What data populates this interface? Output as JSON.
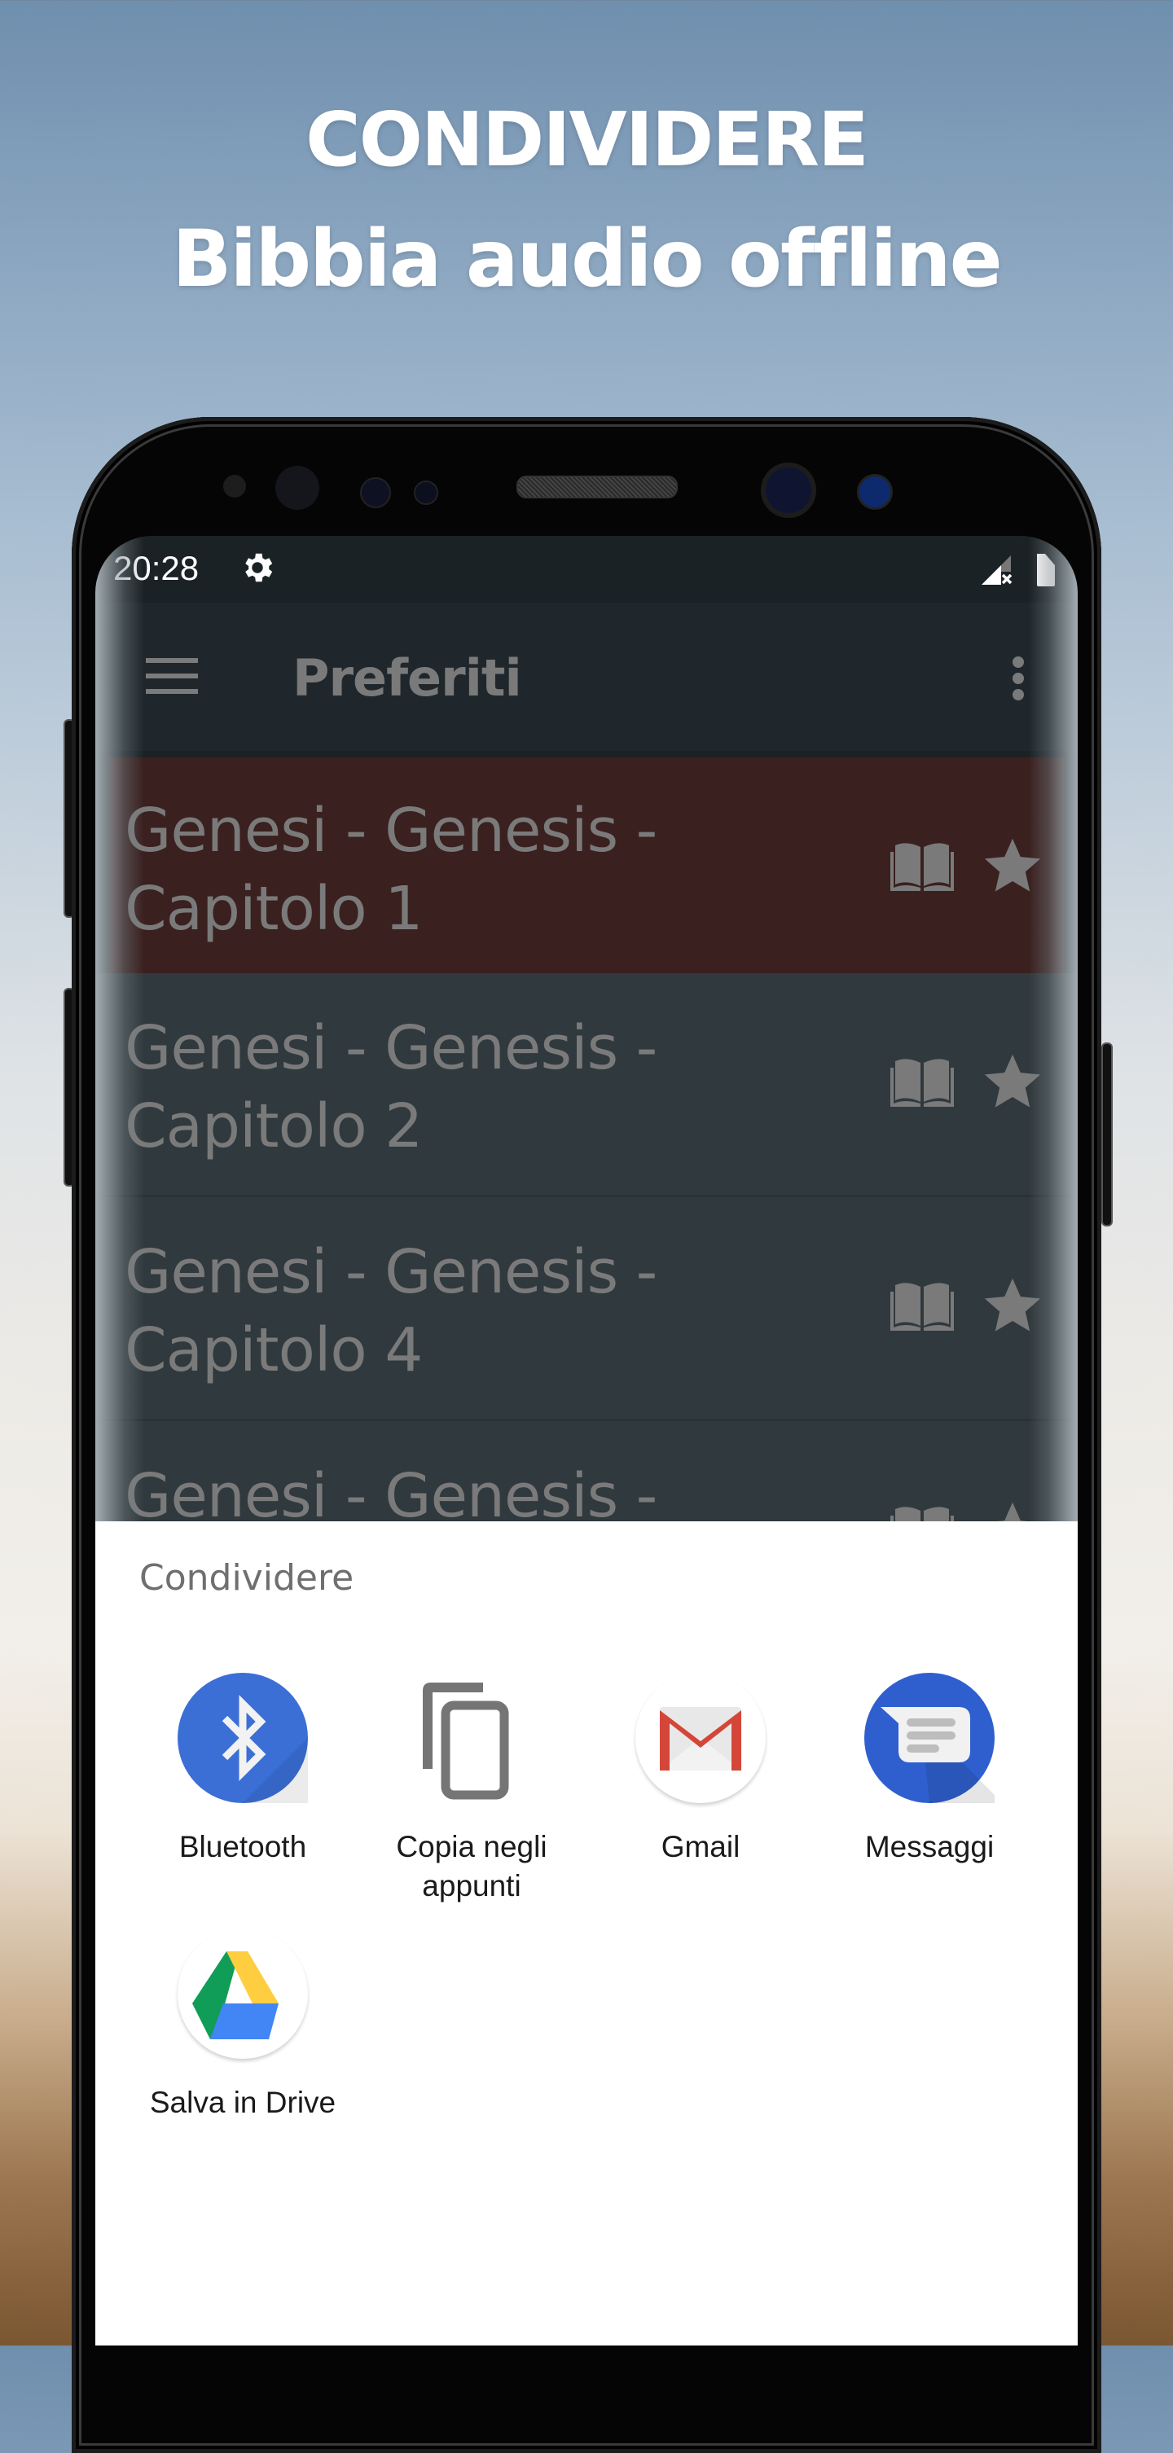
{
  "hero": {
    "line1": "CONDIVIDERE",
    "line2": "Bibbia audio offline"
  },
  "status_bar": {
    "time": "20:28",
    "icons": [
      "settings-gear-icon",
      "signal-no-sim-icon",
      "battery-icon"
    ]
  },
  "app_bar": {
    "menu_icon": "hamburger-menu-icon",
    "title": "Preferiti",
    "overflow_icon": "overflow-menu-icon"
  },
  "favorites": [
    {
      "line1": "Genesi - Genesis -",
      "line2": "Capitolo 1",
      "selected": true,
      "read_icon": "open-book-icon",
      "fav_icon": "star-icon"
    },
    {
      "line1": "Genesi - Genesis -",
      "line2": "Capitolo 2",
      "selected": false,
      "read_icon": "open-book-icon",
      "fav_icon": "star-icon"
    },
    {
      "line1": "Genesi - Genesis -",
      "line2": "Capitolo 4",
      "selected": false,
      "read_icon": "open-book-icon",
      "fav_icon": "star-icon"
    },
    {
      "line1": "Genesi - Genesis -",
      "line2": "",
      "selected": false,
      "read_icon": "open-book-icon",
      "fav_icon": "star-icon"
    }
  ],
  "share_sheet": {
    "title": "Condividere",
    "targets": [
      {
        "label": "Bluetooth",
        "icon": "bluetooth-icon"
      },
      {
        "label": "Copia negli appunti",
        "icon": "copy-clipboard-icon"
      },
      {
        "label": "Gmail",
        "icon": "gmail-icon"
      },
      {
        "label": "Messaggi",
        "icon": "messages-icon"
      },
      {
        "label": "Salva in Drive",
        "icon": "google-drive-icon"
      }
    ]
  },
  "colors": {
    "selected_row": "#3a201f",
    "row": "#30393d",
    "app_bar": "#1f272c",
    "bluetooth_blue": "#3b6fd6",
    "messages_blue": "#2f5fcf",
    "gmail_red": "#d44638"
  }
}
